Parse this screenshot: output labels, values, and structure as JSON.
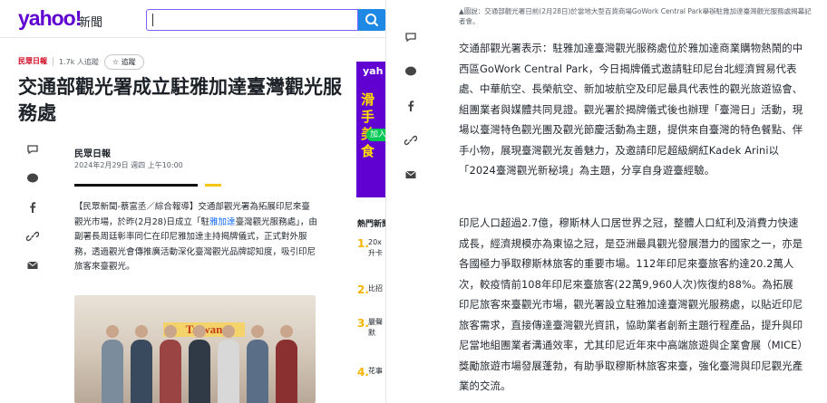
{
  "header": {
    "logo": "yahoo!",
    "logo_sub": "新聞",
    "search_placeholder": ""
  },
  "publisher": {
    "logo_text": "民眾日報",
    "followers": "1.7k 人追蹤",
    "follow_label": "☆ 追蹤"
  },
  "article": {
    "title": "交通部觀光署成立駐雅加達臺灣觀光服務處",
    "author": "民眾日報",
    "date": "2024年2月29日 週四 上午10:00",
    "lead_parts": [
      "【民眾新聞-蔡富丞／綜合報導】交通部觀光署為拓展印尼來臺觀光市場，於昨(2月28)日成立「駐",
      "雅加達",
      "臺灣觀光服務處」，由副署長周廷彰率同仁在印尼雅加達主持揭牌儀式，正式對外服務，透過觀光會傳推廣活動深化臺灣觀光品牌認知度，吸引印尼旅客來臺觀光。"
    ],
    "photo_banner": "Taiwan",
    "caption": "▲圖說：交通部觀光署日前(2月28日)於當地大型百貨商場GoWork Central Park舉辦駐雅加達臺灣觀光服務處揭幕記者會。",
    "para1": "交通部觀光署表示：駐雅加達臺灣觀光服務處位於雅加達商業購物熱鬧的中西區GoWork Central Park，今日揭牌儀式邀請駐印尼台北經濟貿易代表處、中華航空、長榮航空、新加坡航空及印尼最具代表性的觀光旅遊協會、組團業者與媒體共同見證。觀光署於揭牌儀式後也辦理「臺灣日」活動，現場以臺灣特色觀光團及觀光節慶活動為主題，提供來自臺灣的特色餐點、伴手小物，展現臺灣觀光友善魅力，及邀請印尼超級網紅Kadek Arini以「2024臺灣觀光新秘境」為主題，分享自身遊臺經驗。",
    "para2": "印尼人口超過2.7億，穆斯林人口居世界之冠，整體人口紅利及消費力快速成長，經濟規模亦為東協之冠，是亞洲最具觀光發展潛力的國家之一，亦是各國極力爭取穆斯林旅客的重要市場。112年印尼來臺旅客約達20.2萬人次，較疫情前108年印尼來臺旅客(22萬9,960人次)恢復約88%。為拓展印尼旅客來臺觀光市場，觀光署設立駐雅加達臺灣觀光服務處，以貼近印尼旅客需求，直接傳達臺灣觀光資訊，協助業者創新主題行程產品，提升與印尼當地組團業者溝通效率，尤其印尼近年來中高端旅遊與企業會展（MICE）獎勵旅遊市場發展蓬勃，有助爭取穆斯林旅客來臺，強化臺灣與印尼觀光產業的交流。"
  },
  "ad": {
    "brand": "yah",
    "line": "滑手美食",
    "button": "加入"
  },
  "hot": {
    "title": "熱門新聞",
    "items": [
      {
        "num": "1.",
        "text": "20x升卡"
      },
      {
        "num": "2.",
        "text": "比招"
      },
      {
        "num": "3.",
        "text": "嚴聲默"
      },
      {
        "num": "4.",
        "text": "花事"
      }
    ]
  },
  "colors": {
    "yahoo_purple": "#6001d2",
    "link_blue": "#0f69ff",
    "accent_yellow": "#f5c518",
    "search_blue": "#1e88e5"
  }
}
